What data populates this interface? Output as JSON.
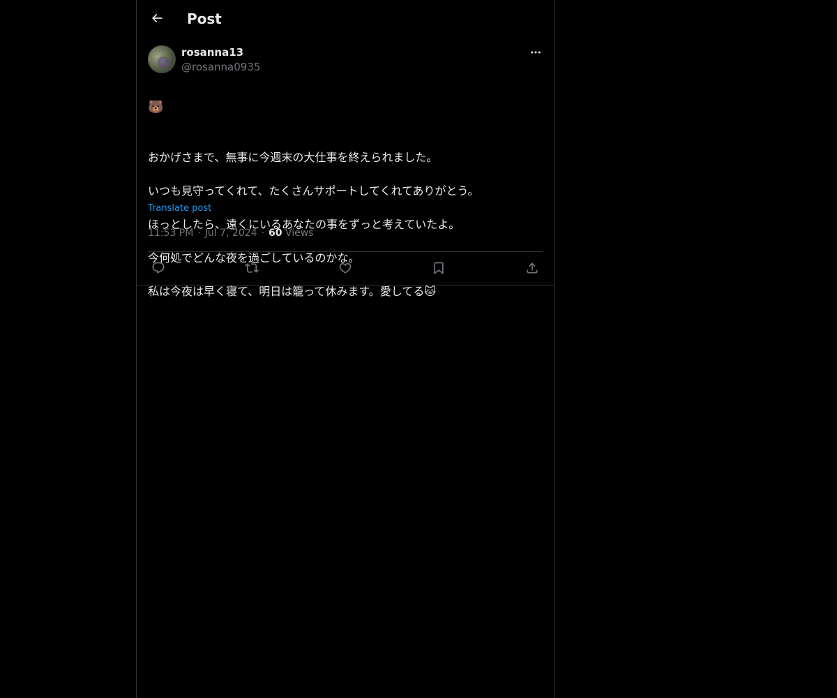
{
  "header": {
    "title": "Post",
    "back_icon": "arrow-left-icon"
  },
  "author": {
    "display_name": "rosanna13",
    "handle": "@rosanna0935"
  },
  "post": {
    "leading_emoji": "🐻",
    "lines": [
      "おかげさまで、無事に今週末の大仕事を終えられました。",
      "いつも見守ってくれて、たくさんサポートしてくれてありがとう。",
      "ほっとしたら、遠くにいるあなたの事をずっと考えていたよ。",
      "今何処でどんな夜を過ごしているのかな。",
      "私は今夜は早く寝て、明日は籠って休みます。愛してる🐱"
    ],
    "translate_label": "Translate post",
    "time": "11:53 PM",
    "date": "Jul 7, 2024",
    "views_count": "60",
    "views_label": "Views"
  },
  "actions": {
    "reply_icon": "reply-icon",
    "repost_icon": "repost-icon",
    "like_icon": "heart-icon",
    "bookmark_icon": "bookmark-icon",
    "share_icon": "share-icon"
  },
  "colors": {
    "background": "#000000",
    "text": "#e7e9ea",
    "secondary": "#71767b",
    "accent": "#1d9bf0",
    "border": "#2f3336"
  }
}
